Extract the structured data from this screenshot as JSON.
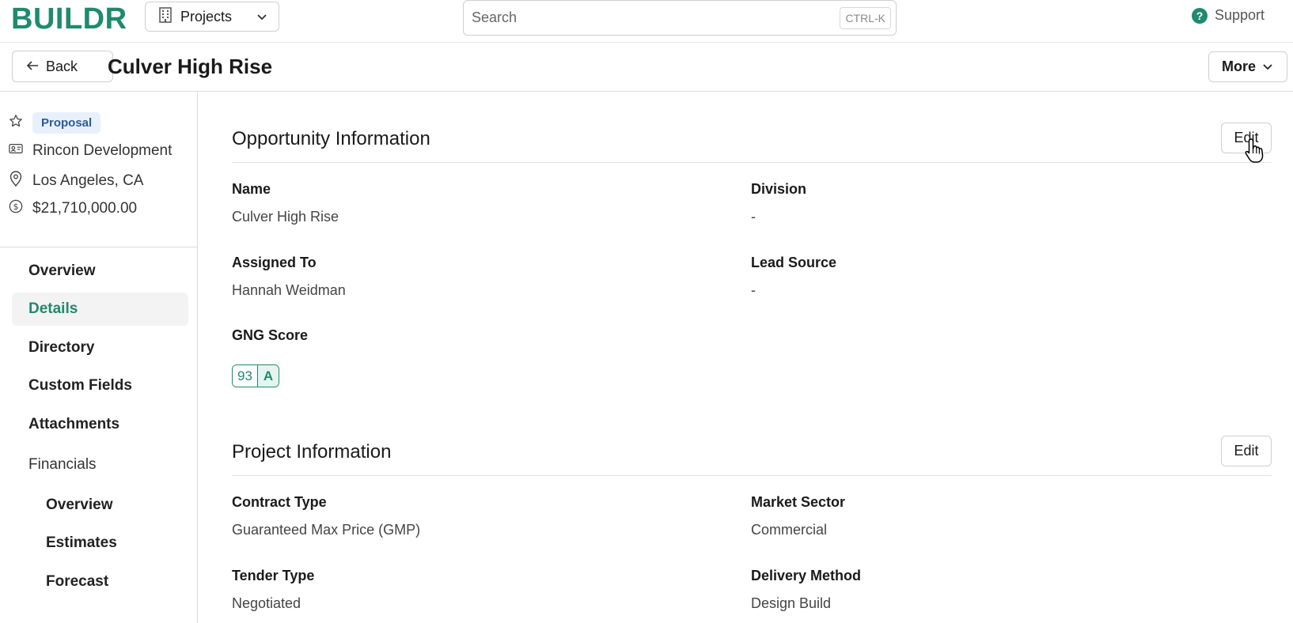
{
  "brand": {
    "logo": "BUILDR",
    "accent": "#1f8a6e"
  },
  "topbar": {
    "projects_label": "Projects",
    "search_placeholder": "Search",
    "search_shortcut": "CTRL-K",
    "support_label": "Support"
  },
  "header": {
    "back_label": "Back",
    "title": "Culver High Rise",
    "more_label": "More"
  },
  "sidebar": {
    "status_badge": "Proposal",
    "company": "Rincon Development",
    "location": "Los Angeles, CA",
    "amount": "$21,710,000.00",
    "nav": {
      "overview": "Overview",
      "details": "Details",
      "directory": "Directory",
      "custom_fields": "Custom Fields",
      "attachments": "Attachments",
      "financials": "Financials",
      "fin_overview": "Overview",
      "estimates": "Estimates",
      "forecast": "Forecast"
    },
    "active_item": "Details"
  },
  "opportunity": {
    "title": "Opportunity Information",
    "edit_label": "Edit",
    "name_label": "Name",
    "name_value": "Culver High Rise",
    "division_label": "Division",
    "division_value": "-",
    "assigned_label": "Assigned To",
    "assigned_value": "Hannah Weidman",
    "lead_label": "Lead Source",
    "lead_value": "-",
    "gng_label": "GNG Score",
    "gng_score": "93",
    "gng_grade": "A"
  },
  "project": {
    "title": "Project Information",
    "edit_label": "Edit",
    "contract_label": "Contract Type",
    "contract_value": "Guaranteed Max Price (GMP)",
    "market_label": "Market Sector",
    "market_value": "Commercial",
    "tender_label": "Tender Type",
    "tender_value": "Negotiated",
    "delivery_label": "Delivery Method",
    "delivery_value": "Design Build"
  }
}
